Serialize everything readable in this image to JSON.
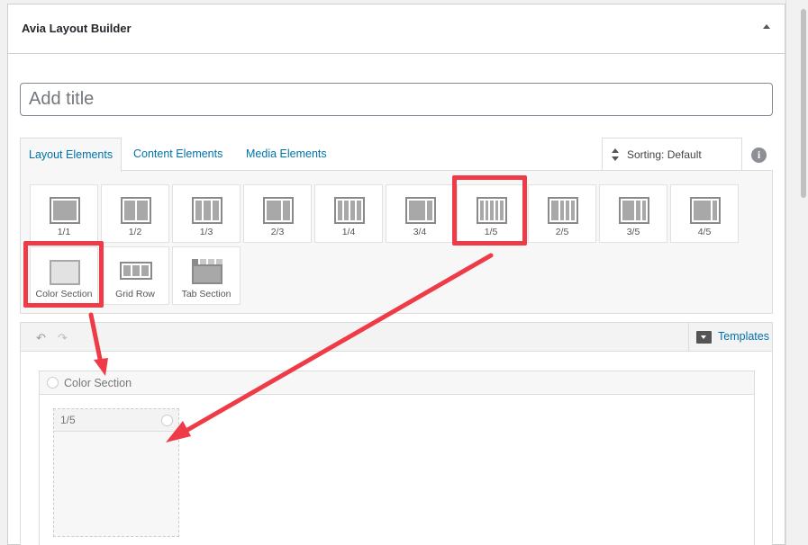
{
  "panel": {
    "title": "Avia Layout Builder"
  },
  "title_input": {
    "placeholder": "Add title"
  },
  "tabs": [
    {
      "label": "Layout Elements"
    },
    {
      "label": "Content Elements"
    },
    {
      "label": "Media Elements"
    }
  ],
  "sorting": {
    "label": "Sorting: Default"
  },
  "info": {
    "glyph": "i"
  },
  "elements": {
    "row1": [
      "1/1",
      "1/2",
      "1/3",
      "2/3",
      "1/4",
      "3/4",
      "1/5",
      "2/5",
      "3/5",
      "4/5"
    ],
    "row2": [
      "Color Section",
      "Grid Row",
      "Tab Section"
    ]
  },
  "toolbar": {
    "undo": "↶",
    "redo": "↷",
    "templates_label": "Templates"
  },
  "canvas": {
    "section_label": "Color Section",
    "column_label": "1/5"
  },
  "colors": {
    "highlight": "#ef3b47",
    "link": "#0073aa"
  }
}
